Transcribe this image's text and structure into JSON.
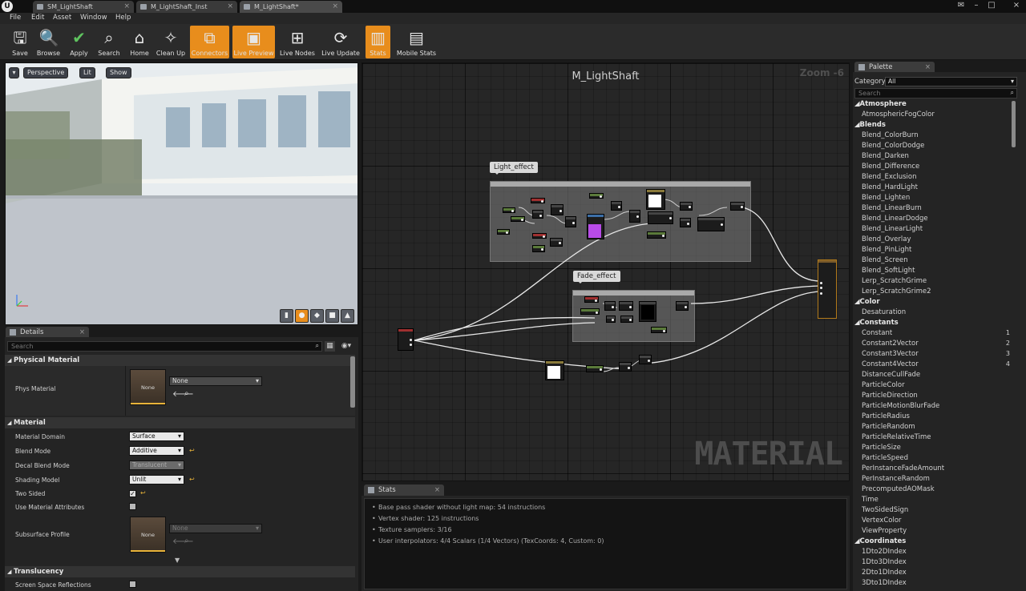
{
  "window": {
    "tabs": [
      {
        "label": "SM_LightShaft",
        "active": false
      },
      {
        "label": "M_LightShaft_Inst",
        "active": false
      },
      {
        "label": "M_LightShaft*",
        "active": true
      }
    ]
  },
  "menu": [
    "File",
    "Edit",
    "Asset",
    "Window",
    "Help"
  ],
  "toolbar": [
    {
      "label": "Save",
      "icon": "save-icon",
      "active": false
    },
    {
      "label": "Browse",
      "icon": "browse-icon",
      "active": false
    },
    {
      "label": "Apply",
      "icon": "check-icon",
      "active": false
    },
    {
      "label": "Search",
      "icon": "search-icon",
      "active": false
    },
    {
      "label": "Home",
      "icon": "home-icon",
      "active": false
    },
    {
      "label": "Clean Up",
      "icon": "broom-icon",
      "active": false
    },
    {
      "label": "Connectors",
      "icon": "connectors-icon",
      "active": true
    },
    {
      "label": "Live Preview",
      "icon": "live-preview-icon",
      "active": true
    },
    {
      "label": "Live Nodes",
      "icon": "live-nodes-icon",
      "active": false
    },
    {
      "label": "Live Update",
      "icon": "live-update-icon",
      "active": false
    },
    {
      "label": "Stats",
      "icon": "stats-icon",
      "active": true
    },
    {
      "label": "Mobile Stats",
      "icon": "mobile-stats-icon",
      "active": false
    }
  ],
  "viewport": {
    "perspective": "Perspective",
    "lit": "Lit",
    "show": "Show"
  },
  "details": {
    "tab": "Details",
    "search_placeholder": "Search",
    "physical_material_header": "Physical Material",
    "phys_material_label": "Phys Material",
    "phys_material_thumb": "None",
    "phys_material_value": "None",
    "material_header": "Material",
    "props": {
      "material_domain": {
        "label": "Material Domain",
        "value": "Surface"
      },
      "blend_mode": {
        "label": "Blend Mode",
        "value": "Additive"
      },
      "decal_blend_mode": {
        "label": "Decal Blend Mode",
        "value": "Translucent"
      },
      "shading_model": {
        "label": "Shading Model",
        "value": "Unlit"
      },
      "two_sided": {
        "label": "Two Sided",
        "checked": true
      },
      "use_material_attributes": {
        "label": "Use Material Attributes",
        "checked": false
      },
      "subsurface_profile": {
        "label": "Subsurface Profile",
        "thumb": "None",
        "value": "None"
      }
    },
    "translucency_header": "Translucency",
    "screen_space_reflections": {
      "label": "Screen Space Reflections",
      "checked": false
    }
  },
  "graph": {
    "title": "M_LightShaft",
    "zoom": "Zoom -6",
    "watermark": "MATERIAL",
    "comments": [
      "Light_effect",
      "Fade_effect"
    ]
  },
  "stats": {
    "tab": "Stats",
    "lines": [
      "Base pass shader without light map: 54 instructions",
      "Vertex shader: 125 instructions",
      "Texture samplers: 3/16",
      "User interpolators: 4/4 Scalars (1/4 Vectors) (TexCoords: 4, Custom: 0)"
    ]
  },
  "palette": {
    "tab": "Palette",
    "category_label": "Category:",
    "category_value": "All",
    "search_placeholder": "Search",
    "entries": [
      {
        "kind": "head",
        "text": "Atmosphere"
      },
      {
        "kind": "item",
        "text": "AtmosphericFogColor"
      },
      {
        "kind": "head",
        "text": "Blends"
      },
      {
        "kind": "item",
        "text": "Blend_ColorBurn"
      },
      {
        "kind": "item",
        "text": "Blend_ColorDodge"
      },
      {
        "kind": "item",
        "text": "Blend_Darken"
      },
      {
        "kind": "item",
        "text": "Blend_Difference"
      },
      {
        "kind": "item",
        "text": "Blend_Exclusion"
      },
      {
        "kind": "item",
        "text": "Blend_HardLight"
      },
      {
        "kind": "item",
        "text": "Blend_Lighten"
      },
      {
        "kind": "item",
        "text": "Blend_LinearBurn"
      },
      {
        "kind": "item",
        "text": "Blend_LinearDodge"
      },
      {
        "kind": "item",
        "text": "Blend_LinearLight"
      },
      {
        "kind": "item",
        "text": "Blend_Overlay"
      },
      {
        "kind": "item",
        "text": "Blend_PinLight"
      },
      {
        "kind": "item",
        "text": "Blend_Screen"
      },
      {
        "kind": "item",
        "text": "Blend_SoftLight"
      },
      {
        "kind": "item",
        "text": "Lerp_ScratchGrime"
      },
      {
        "kind": "item",
        "text": "Lerp_ScratchGrime2"
      },
      {
        "kind": "head",
        "text": "Color"
      },
      {
        "kind": "item",
        "text": "Desaturation"
      },
      {
        "kind": "head",
        "text": "Constants"
      },
      {
        "kind": "item",
        "text": "Constant",
        "key": "1"
      },
      {
        "kind": "item",
        "text": "Constant2Vector",
        "key": "2"
      },
      {
        "kind": "item",
        "text": "Constant3Vector",
        "key": "3"
      },
      {
        "kind": "item",
        "text": "Constant4Vector",
        "key": "4"
      },
      {
        "kind": "item",
        "text": "DistanceCullFade"
      },
      {
        "kind": "item",
        "text": "ParticleColor"
      },
      {
        "kind": "item",
        "text": "ParticleDirection"
      },
      {
        "kind": "item",
        "text": "ParticleMotionBlurFade"
      },
      {
        "kind": "item",
        "text": "ParticleRadius"
      },
      {
        "kind": "item",
        "text": "ParticleRandom"
      },
      {
        "kind": "item",
        "text": "ParticleRelativeTime"
      },
      {
        "kind": "item",
        "text": "ParticleSize"
      },
      {
        "kind": "item",
        "text": "ParticleSpeed"
      },
      {
        "kind": "item",
        "text": "PerInstanceFadeAmount"
      },
      {
        "kind": "item",
        "text": "PerInstanceRandom"
      },
      {
        "kind": "item",
        "text": "PrecomputedAOMask"
      },
      {
        "kind": "item",
        "text": "Time"
      },
      {
        "kind": "item",
        "text": "TwoSidedSign"
      },
      {
        "kind": "item",
        "text": "VertexColor"
      },
      {
        "kind": "item",
        "text": "ViewProperty"
      },
      {
        "kind": "head",
        "text": "Coordinates"
      },
      {
        "kind": "item",
        "text": "1Dto2DIndex"
      },
      {
        "kind": "item",
        "text": "1Dto3DIndex"
      },
      {
        "kind": "item",
        "text": "2Dto1DIndex"
      },
      {
        "kind": "item",
        "text": "3Dto1DIndex"
      }
    ]
  },
  "colors": {
    "accent": "#e88d1c",
    "reset_arrow": "#e8b33a"
  }
}
